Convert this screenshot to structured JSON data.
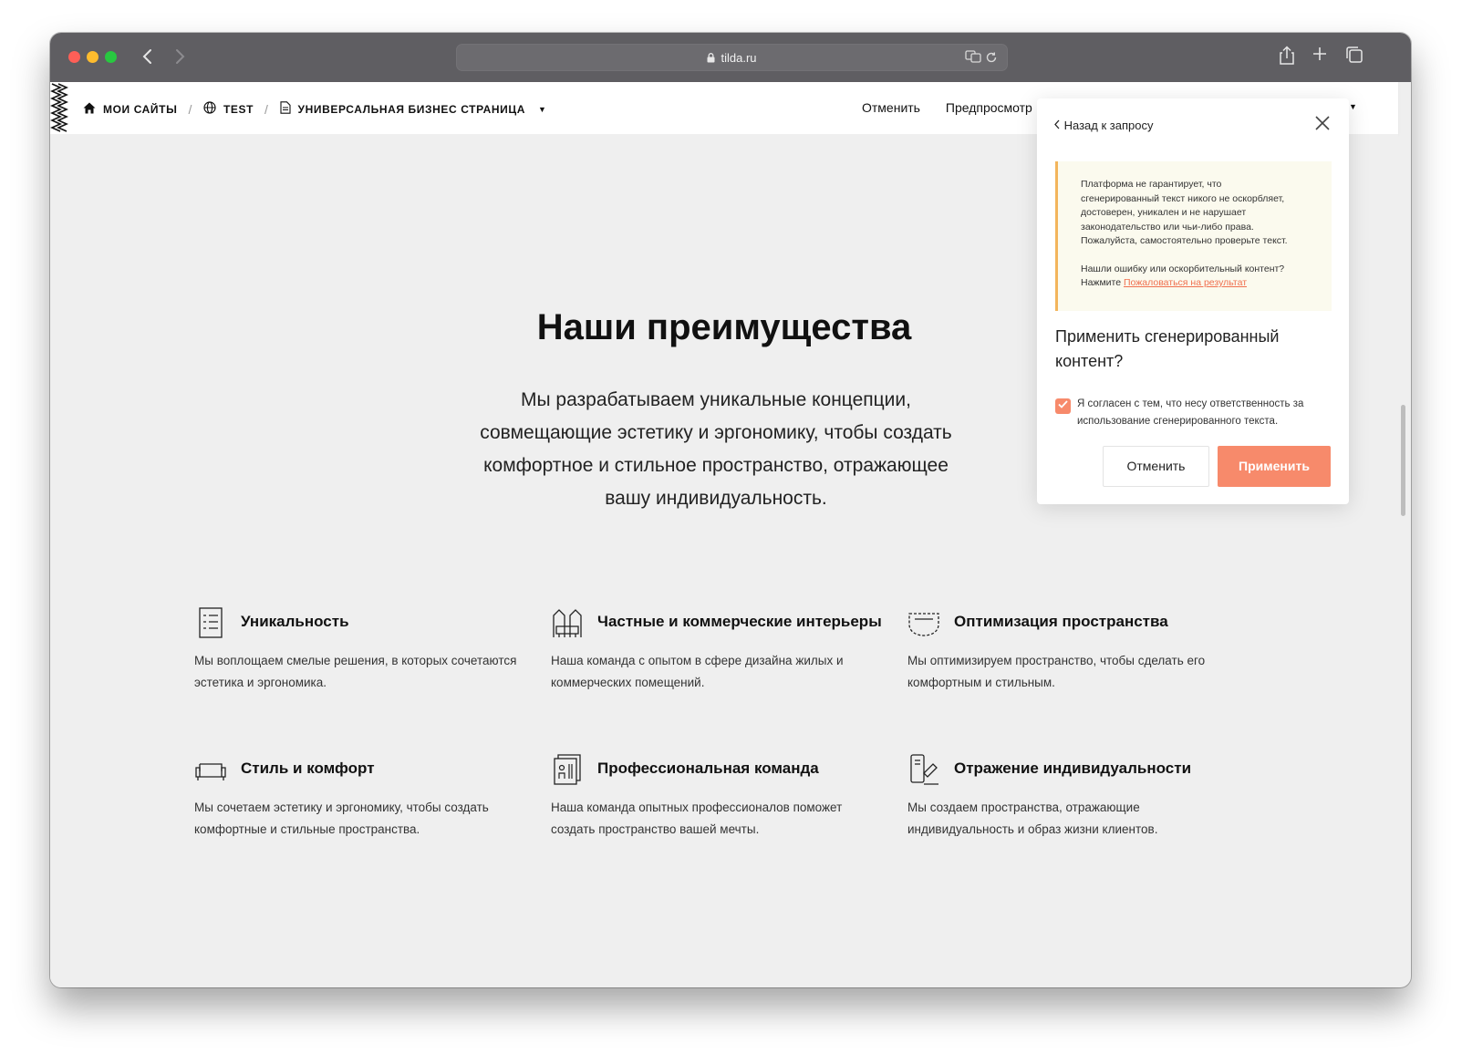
{
  "browser": {
    "url": "tilda.ru",
    "colors": {
      "chrome": "#5f5e62",
      "close": "#fe5f57",
      "minimize": "#febc2e",
      "zoom": "#28c840"
    }
  },
  "header": {
    "breadcrumbs": [
      {
        "label": "МОИ САЙТЫ",
        "icon": "home-icon"
      },
      {
        "label": "TEST",
        "icon": "globe-icon"
      },
      {
        "label": "УНИВЕРСАЛЬНАЯ БИЗНЕС СТРАНИЦА",
        "icon": "page-icon"
      }
    ],
    "cancel_label": "Отменить",
    "preview_label": "Предпросмотр"
  },
  "content": {
    "title": "Наши преимущества",
    "lead": "Мы разрабатываем уникальные концепции, совмещающие эстетику и эргономику, чтобы создать комфортное и стильное пространство, отражающее вашу индивидуальность.",
    "features": [
      {
        "icon": "checklist-icon",
        "title": "Уникальность",
        "desc": "Мы воплощаем смелые решения, в которых сочетаются эстетика и эргономика."
      },
      {
        "icon": "interior-icon",
        "title": "Частные и коммерческие интерьеры",
        "desc": "Наша команда с опытом в сфере дизайна жилых и коммерческих помещений."
      },
      {
        "icon": "space-icon",
        "title": "Оптимизация пространства",
        "desc": "Мы оптимизируем пространство, чтобы сделать его комфортным и стильным."
      },
      {
        "icon": "sofa-icon",
        "title": "Стиль и комфорт",
        "desc": "Мы сочетаем эстетику и эргономику, чтобы создать комфортные и стильные пространства."
      },
      {
        "icon": "team-icon",
        "title": "Профессиональная команда",
        "desc": "Наша команда опытных профессионалов поможет создать пространство вашей мечты."
      },
      {
        "icon": "mirror-icon",
        "title": "Отражение индивидуальности",
        "desc": "Мы создаем пространства, отражающие индивидуальность и образ жизни клиентов."
      }
    ]
  },
  "panel": {
    "back_label": "Назад к запросу",
    "notice_lines": [
      "Платформа не гарантирует, что",
      "сгенерированный текст никого не оскорбляет,",
      "достоверен, уникален и не нарушает",
      "законодательство или чьи-либо права.",
      "Пожалуйста, самостоятельно проверьте текст."
    ],
    "notice_question": "Нашли ошибку или оскорбительный контент?",
    "notice_press": "Нажмите",
    "report_link": "Пожаловаться на результат",
    "question": "Применить сгенерированный контент?",
    "agree_text": "Я согласен с тем, что несу ответственность за использование сгенерированного текста.",
    "agree_checked": true,
    "cancel_label": "Отменить",
    "apply_label": "Применить",
    "accent_color": "#f78a6b"
  },
  "help_button": {
    "label": "?"
  }
}
